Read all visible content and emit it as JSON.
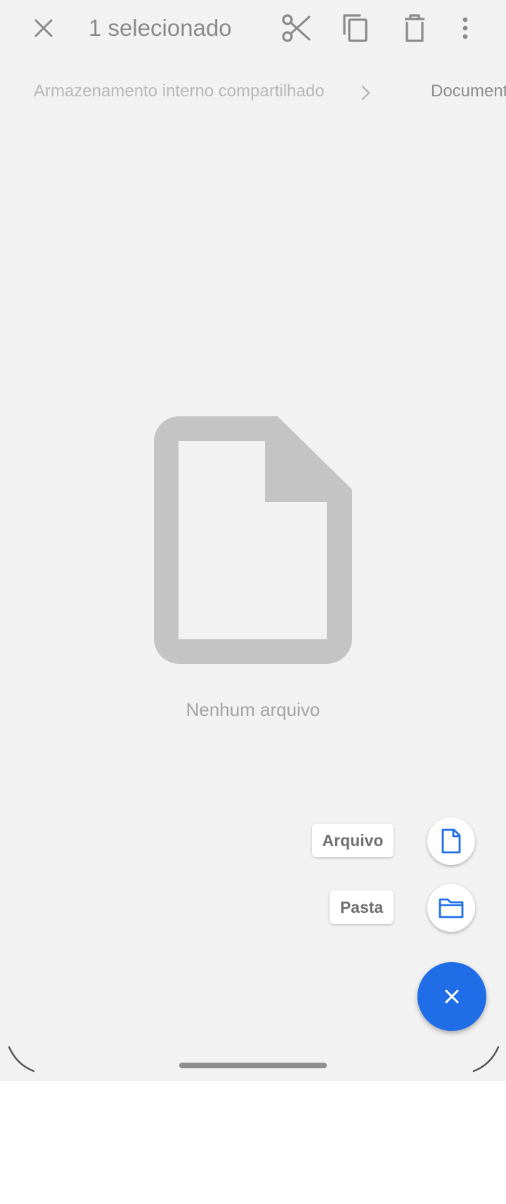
{
  "top_bar": {
    "title": "1 selecionado",
    "icons": [
      "close-icon",
      "scissors-icon",
      "copy-icon",
      "trash-icon",
      "more-vert-icon"
    ]
  },
  "breadcrumb": {
    "root": "Armazenamento interno compartilhado",
    "current": "Documents"
  },
  "empty_state": {
    "message": "Nenhum arquivo",
    "icon": "blank-file-icon"
  },
  "speed_dial": {
    "file_label": "Arquivo",
    "folder_label": "Pasta",
    "main_icon": "close-icon"
  },
  "colors": {
    "accent": "#1f6ee8",
    "background": "#f2f2f2"
  }
}
